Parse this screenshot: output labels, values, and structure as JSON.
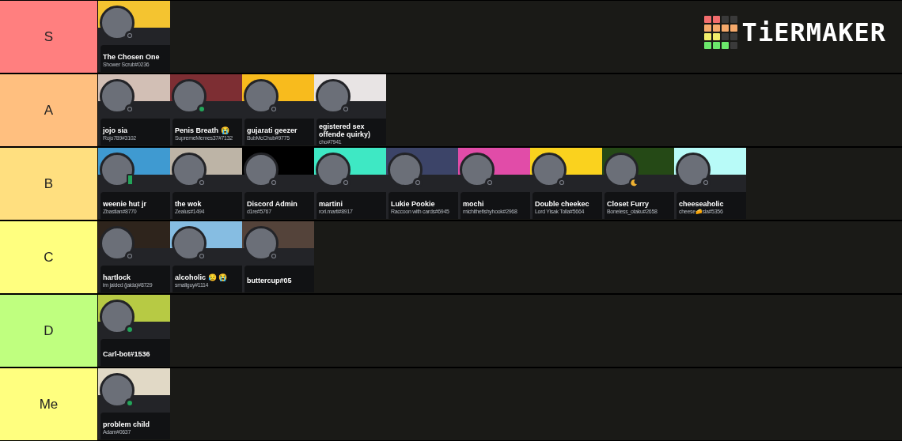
{
  "logo": {
    "text": "TiERMAKER"
  },
  "tiers": [
    {
      "label": "S",
      "color": "#ff7f7f",
      "cards": [
        {
          "name": "The Chosen One",
          "tag": "Shower Scrub#0236",
          "color": "#f4c430",
          "kind": "offline"
        }
      ]
    },
    {
      "label": "A",
      "color": "#ffbf7f",
      "cards": [
        {
          "name": "jojo sia",
          "tag": "Rojo789#3102",
          "color": "#d2bfb5",
          "kind": "offline"
        },
        {
          "name": "Penis Breath 😭",
          "tag": "SupremeMemes37#7132",
          "color": "#7d2e33",
          "kind": "online"
        },
        {
          "name": "gujarati geezer",
          "tag": "BubMcChub#9775",
          "color": "#f8bb1d",
          "kind": "offline"
        },
        {
          "name": "egistered sex offende quirky)",
          "tag": "cho#7941",
          "color": "#e8e4e4",
          "kind": "offline"
        }
      ]
    },
    {
      "label": "B",
      "color": "#ffdf7f",
      "cards": [
        {
          "name": "weenie hut jr",
          "tag": "Zbastian#8770",
          "color": "#3f9ad1",
          "kind": "mobile"
        },
        {
          "name": "the wok",
          "tag": "Zealus#1494",
          "color": "#bdb4a6",
          "kind": "offline"
        },
        {
          "name": "Discord Admin",
          "tag": "d1re#5767",
          "color": "#000000",
          "kind": "offline"
        },
        {
          "name": "martini",
          "tag": "rori.marti#8917",
          "color": "#3ee8c4",
          "kind": "offline"
        },
        {
          "name": "Lukie Pookie",
          "tag": "Raccoon with cards#6945",
          "color": "#3c4468",
          "kind": "offline"
        },
        {
          "name": "mochi",
          "tag": "michithefishyhook#2968",
          "color": "#e14ca8",
          "kind": "offline"
        },
        {
          "name": "Double cheekec",
          "tag": "Lord Yisak Tolla#5664",
          "color": "#fad21e",
          "kind": "offline"
        },
        {
          "name": "Closet Furry",
          "tag": "Boneless_otaku#2658",
          "color": "#254916",
          "kind": "idle"
        },
        {
          "name": "cheeseaholic",
          "tag": "cheese🧀sla#5356",
          "color": "#b8fbf8",
          "kind": "offline"
        }
      ]
    },
    {
      "label": "C",
      "color": "#ffff7f",
      "cards": [
        {
          "name": "hartlock",
          "tag": "im jaided (jaida)#8729",
          "color": "#2e241c",
          "kind": "offline"
        },
        {
          "name": "alcoholic 😥 😭",
          "tag": "smallguy#1114",
          "color": "#86bde2",
          "kind": "offline"
        },
        {
          "name": "buttercup#05",
          "color": "#54433a",
          "kind": "offline"
        }
      ]
    },
    {
      "label": "D",
      "color": "#bfff7f",
      "cards": [
        {
          "name": "Carl-bot#1536",
          "color": "#b7ca44",
          "kind": "online"
        }
      ]
    },
    {
      "label": "Me",
      "color": "#ffff7f",
      "cards": [
        {
          "name": "problem child",
          "tag": "Adam#0637",
          "color": "#e1d9c6",
          "kind": "online"
        }
      ]
    }
  ]
}
